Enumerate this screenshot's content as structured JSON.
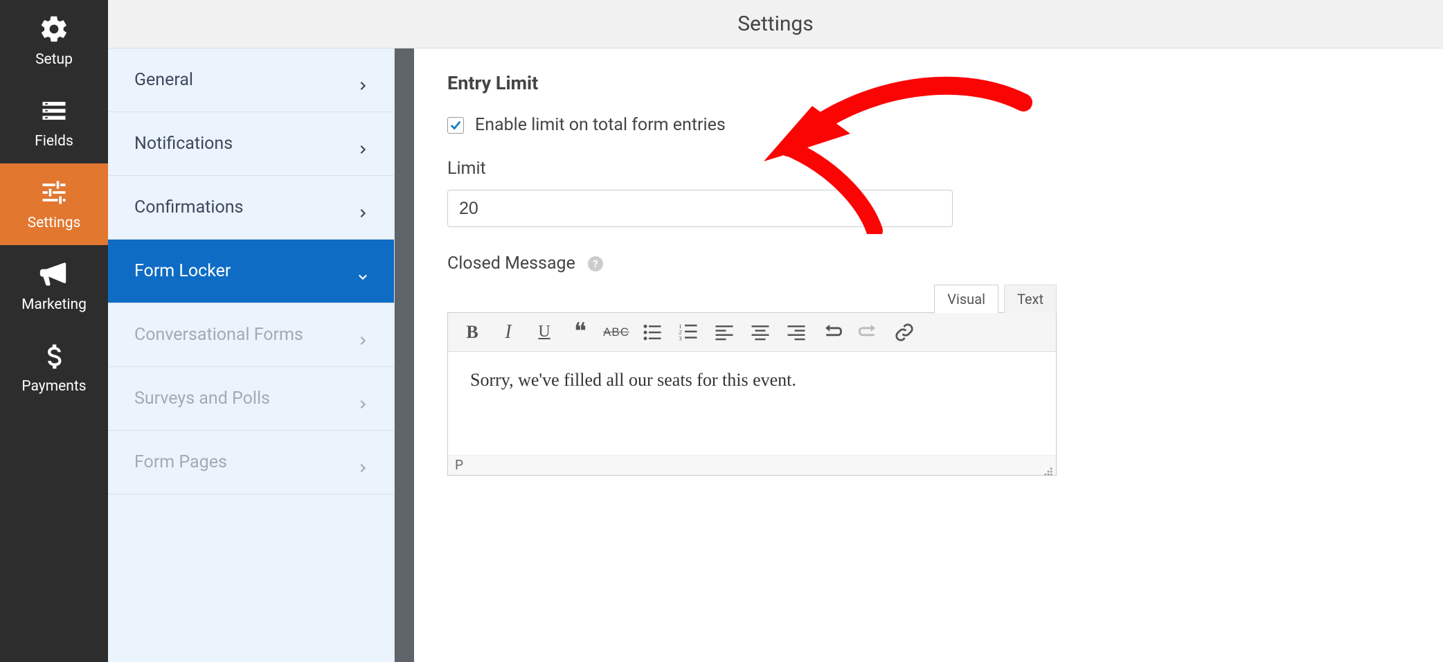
{
  "header": {
    "title": "Settings"
  },
  "nav": {
    "items": [
      {
        "label": "Setup"
      },
      {
        "label": "Fields"
      },
      {
        "label": "Settings"
      },
      {
        "label": "Marketing"
      },
      {
        "label": "Payments"
      }
    ]
  },
  "submenu": {
    "items": [
      {
        "label": "General"
      },
      {
        "label": "Notifications"
      },
      {
        "label": "Confirmations"
      },
      {
        "label": "Form Locker"
      },
      {
        "label": "Conversational Forms"
      },
      {
        "label": "Surveys and Polls"
      },
      {
        "label": "Form Pages"
      }
    ]
  },
  "content": {
    "section_title": "Entry Limit",
    "checkbox_label": "Enable limit on total form entries",
    "limit_label": "Limit",
    "limit_value": "20",
    "closed_label": "Closed Message",
    "editor_tabs": {
      "visual": "Visual",
      "text": "Text"
    },
    "editor_body": "Sorry, we've filled all our seats for this event.",
    "editor_status": "P"
  }
}
